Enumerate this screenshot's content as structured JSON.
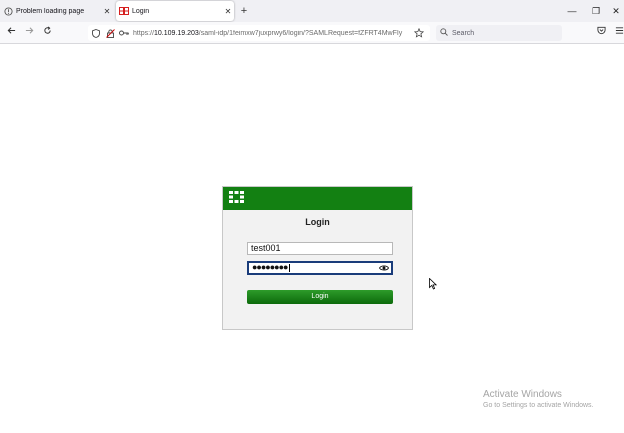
{
  "browser": {
    "tabs": [
      {
        "label": "Problem loading page",
        "close": "✕",
        "icon": "page-icon"
      },
      {
        "label": "Login",
        "close": "✕",
        "icon": "fortinet-favicon"
      }
    ],
    "new_tab": "+",
    "window_controls": {
      "minimize": "—",
      "restore": "❐",
      "close": "✕"
    },
    "url_host": "10.109.19.203",
    "url_prefix": "https://",
    "url_rest": "/saml-idp/1feimxw7juxprwy6/login/?SAMLRequest=fZFRT4MwFIy",
    "search_placeholder": "Search"
  },
  "login": {
    "title": "Login",
    "username": "test001",
    "password_mask": "●●●●●●●●",
    "button_label": "Login",
    "header_color": "#138012"
  },
  "watermark": {
    "line1": "Activate Windows",
    "line2": "Go to Settings to activate Windows."
  }
}
